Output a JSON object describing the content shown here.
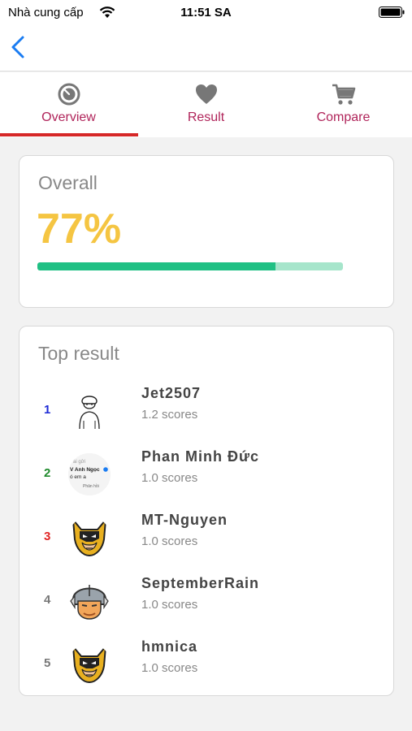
{
  "status_bar": {
    "carrier": "Nhà cung cấp",
    "time": "11:51 SA"
  },
  "tabs": [
    {
      "label": "Overview",
      "icon": "timer-icon",
      "active": true
    },
    {
      "label": "Result",
      "icon": "heart-icon",
      "active": false
    },
    {
      "label": "Compare",
      "icon": "cart-icon",
      "active": false
    }
  ],
  "overall": {
    "title": "Overall",
    "value": "77%",
    "progress": 0.78
  },
  "top_result": {
    "title": "Top result",
    "items": [
      {
        "rank": "1",
        "rank_color": "#1e2bd6",
        "name": "Jet2507",
        "score": "1.2 scores",
        "avatar": "sketch-avatar"
      },
      {
        "rank": "2",
        "rank_color": "#1f8a2c",
        "name": "Phan Minh Đức",
        "score": "1.0 scores",
        "avatar": "screenshot-avatar",
        "avatar_text": [
          "ai gửi",
          "V Anh Ngọc",
          "ó em a",
          "Phản hồi"
        ]
      },
      {
        "rank": "3",
        "rank_color": "#e02424",
        "name": "MT-Nguyen",
        "score": "1.0 scores",
        "avatar": "masked-hero-avatar"
      },
      {
        "rank": "4",
        "rank_color": "#777777",
        "name": "SeptemberRain",
        "score": "1.0 scores",
        "avatar": "helmet-avatar"
      },
      {
        "rank": "5",
        "rank_color": "#777777",
        "name": "hmnica",
        "score": "1.0 scores",
        "avatar": "masked-hero-avatar"
      }
    ]
  },
  "colors": {
    "accent": "#b0245a",
    "tab_indicator": "#d62828",
    "overall_value": "#f5c542",
    "progress_fill": "#20c084",
    "progress_track": "#a6e5cb",
    "back_arrow": "#1a7cf2"
  }
}
